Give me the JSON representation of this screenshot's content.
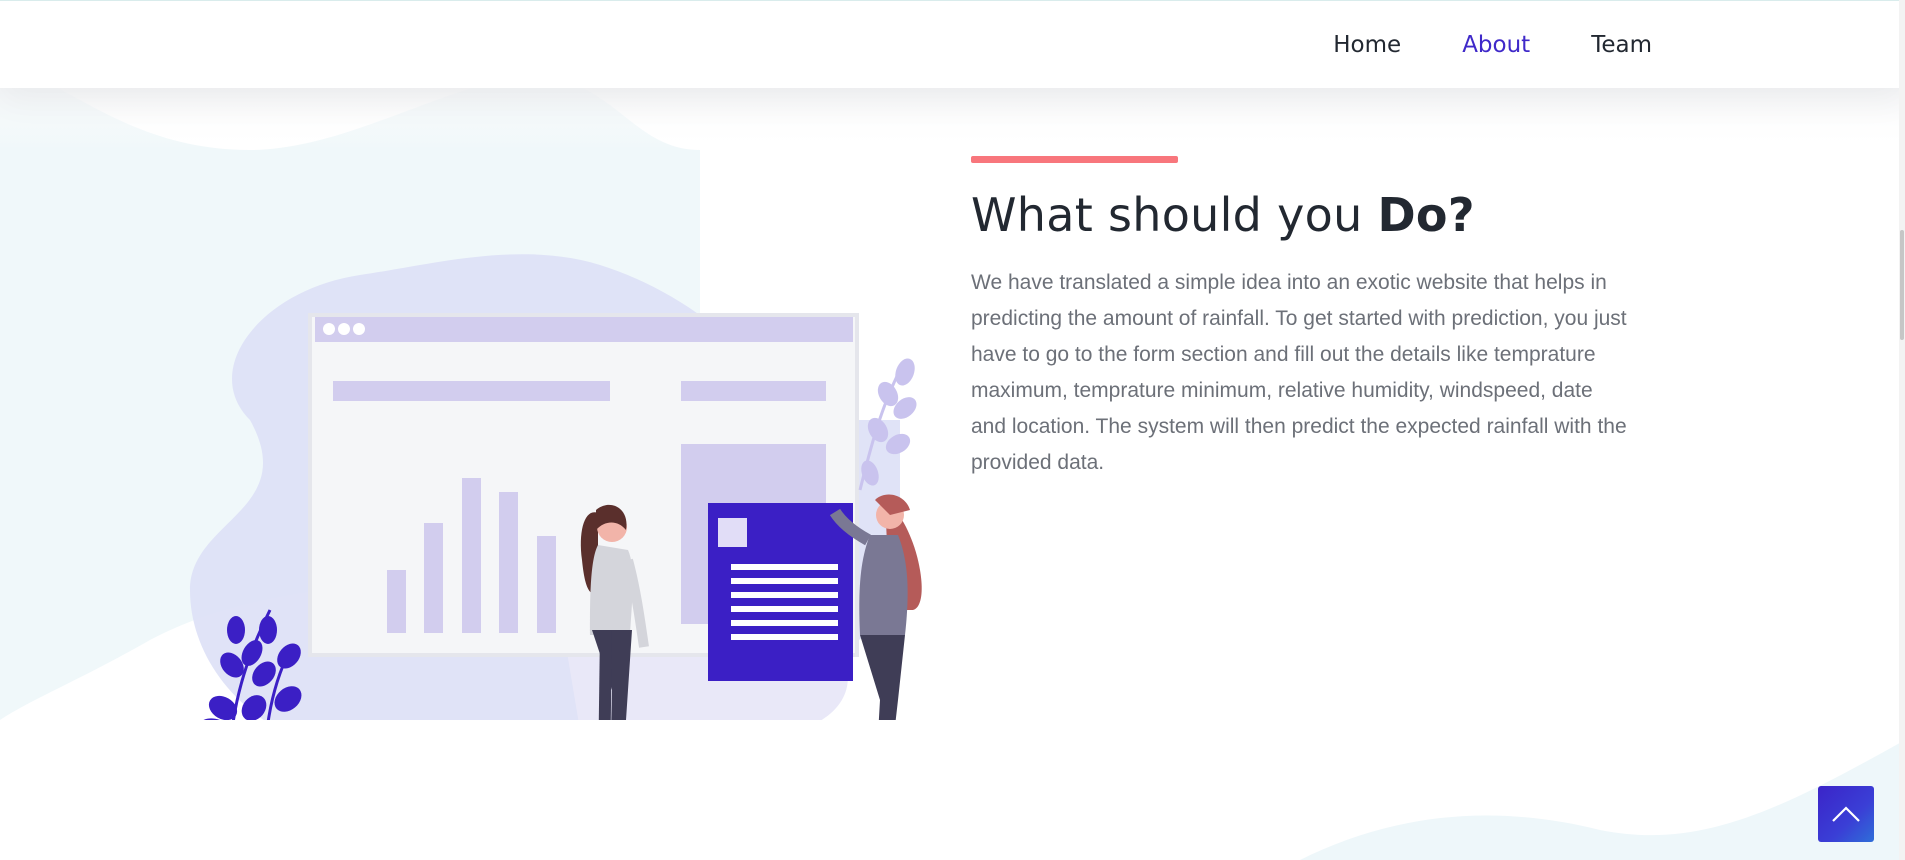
{
  "nav": {
    "items": [
      {
        "label": "Home",
        "active": false
      },
      {
        "label": "About",
        "active": true
      },
      {
        "label": "Team",
        "active": false
      }
    ]
  },
  "about": {
    "title_regular": "What should you ",
    "title_bold": "Do?",
    "description": "We have translated a simple idea into an exotic website that helps in predicting the amount of rainfall. To get started with prediction, you just have to go to the form section and fill out the details like temprature maximum, temprature minimum, relative humidity, windspeed, date and location. The system will then predict the expected rainfall with the provided data."
  },
  "colors": {
    "accent": "#3f29c9",
    "heading_bar": "#f8767c",
    "text_dark": "#222831",
    "text_body": "#6c7078"
  },
  "icons": {
    "scroll_top": "chevron-up-icon",
    "illustration": "analytics-dashboard-illustration"
  }
}
